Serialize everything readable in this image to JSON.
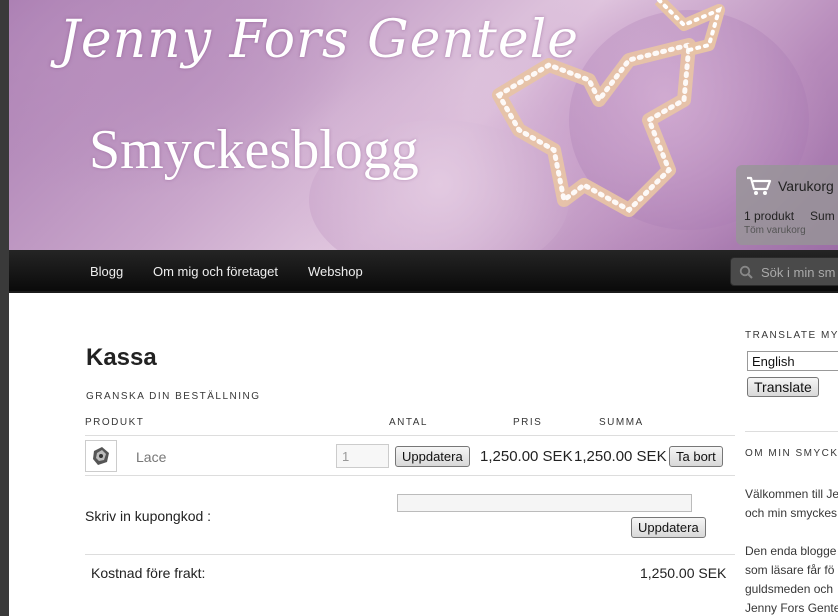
{
  "banner": {
    "title_script": "Jenny Fors Gentele",
    "title_blog": "Smyckesblogg"
  },
  "cart": {
    "title": "Varukorg",
    "count": "1 produkt",
    "sum_label": "Sum",
    "empty_label": "Töm varukorg"
  },
  "nav": {
    "items": [
      "Blogg",
      "Om mig och företaget",
      "Webshop"
    ],
    "search_placeholder": "Sök i min sm"
  },
  "checkout": {
    "title": "Kassa",
    "review_heading": "GRANSKA DIN BESTÄLLNING",
    "columns": [
      "PRODUKT",
      "ANTAL",
      "PRIS",
      "SUMMA"
    ],
    "row": {
      "name": "Lace",
      "quantity": "1",
      "update_label": "Uppdatera",
      "price": "1,250.00 SEK",
      "sum": "1,250.00 SEK",
      "remove_label": "Ta bort"
    },
    "coupon_label": "Skriv in kupongkod :",
    "coupon_update_label": "Uppdatera",
    "subtotal_label": "Kostnad före frakt:",
    "subtotal_value": "1,250.00 SEK"
  },
  "sidebar": {
    "translate_title": "TRANSLATE MY",
    "language": "English",
    "translate_button": "Translate",
    "about_title": "OM MIN SMYCKE",
    "about_lines": [
      "Välkommen till Je",
      "och min smyckes",
      "Den enda blogge",
      "som läsare får fö",
      "guldsmeden och",
      "Jenny Fors Gente"
    ]
  },
  "colors": {
    "nav_bg": "#111111",
    "banner_purple": "#b88fbd"
  }
}
